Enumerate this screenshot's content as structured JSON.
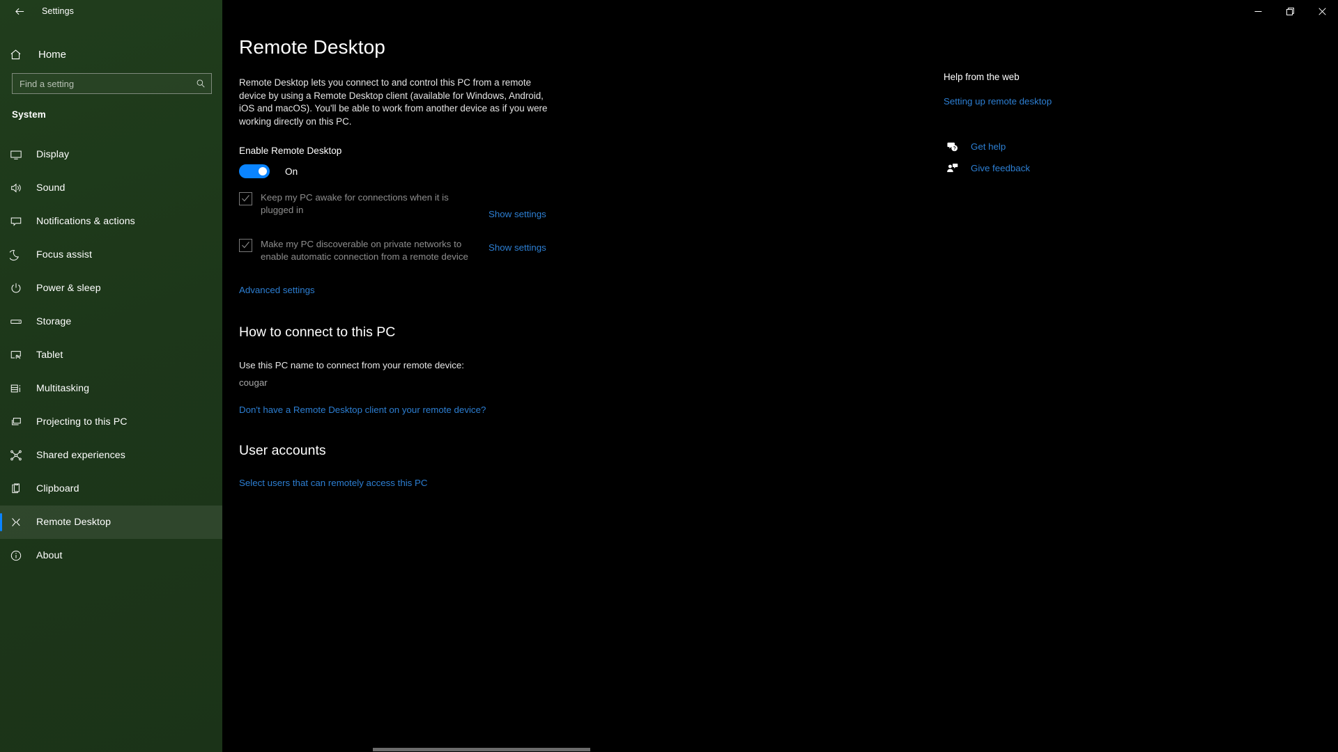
{
  "window": {
    "title": "Settings",
    "back_icon": "back-arrow-icon",
    "minimize_label": "Minimize",
    "restore_label": "Restore",
    "close_label": "Close"
  },
  "sidebar": {
    "home_label": "Home",
    "home_icon": "home-icon",
    "search": {
      "placeholder": "Find a setting",
      "value": "",
      "icon": "search-icon"
    },
    "group_label": "System",
    "items": [
      {
        "label": "Display",
        "icon": "monitor-icon",
        "active": false
      },
      {
        "label": "Sound",
        "icon": "speaker-icon",
        "active": false
      },
      {
        "label": "Notifications & actions",
        "icon": "notification-icon",
        "active": false
      },
      {
        "label": "Focus assist",
        "icon": "moon-icon",
        "active": false
      },
      {
        "label": "Power & sleep",
        "icon": "power-icon",
        "active": false
      },
      {
        "label": "Storage",
        "icon": "drive-icon",
        "active": false
      },
      {
        "label": "Tablet",
        "icon": "tablet-icon",
        "active": false
      },
      {
        "label": "Multitasking",
        "icon": "multitask-icon",
        "active": false
      },
      {
        "label": "Projecting to this PC",
        "icon": "project-icon",
        "active": false
      },
      {
        "label": "Shared experiences",
        "icon": "share-nodes-icon",
        "active": false
      },
      {
        "label": "Clipboard",
        "icon": "clipboard-icon",
        "active": false
      },
      {
        "label": "Remote Desktop",
        "icon": "remote-desktop-icon",
        "active": true
      },
      {
        "label": "About",
        "icon": "info-icon",
        "active": false
      }
    ]
  },
  "main": {
    "page_title": "Remote Desktop",
    "intro": "Remote Desktop lets you connect to and control this PC from a remote device by using a Remote Desktop client (available for Windows, Android, iOS and macOS). You'll be able to work from another device as if you were working directly on this PC.",
    "enable_label": "Enable Remote Desktop",
    "toggle_state": "On",
    "checkbox_keep_awake": "Keep my PC awake for connections when it is plugged in",
    "checkbox_discoverable": "Make my PC discoverable on private networks to enable automatic connection from a remote device",
    "show_settings_1": "Show settings",
    "show_settings_2": "Show settings",
    "advanced_settings": "Advanced settings",
    "how_to_connect_heading": "How to connect to this PC",
    "pc_name_label": "Use this PC name to connect from your remote device:",
    "pc_name_value": "cougar",
    "no_client_link": "Don't have a Remote Desktop client on your remote device?",
    "user_accounts_heading": "User accounts",
    "select_users_link": "Select users that can remotely access this PC"
  },
  "help": {
    "title": "Help from the web",
    "link": "Setting up remote desktop",
    "get_help": "Get help",
    "get_help_icon": "question-bubble-icon",
    "give_feedback": "Give feedback",
    "give_feedback_icon": "feedback-person-icon"
  },
  "colors": {
    "accent": "#0a84ff",
    "link": "#2d7fd3",
    "sidebar_bg": "#1e3a1a",
    "main_bg": "#000000",
    "disabled_text": "#8e8e8e"
  }
}
